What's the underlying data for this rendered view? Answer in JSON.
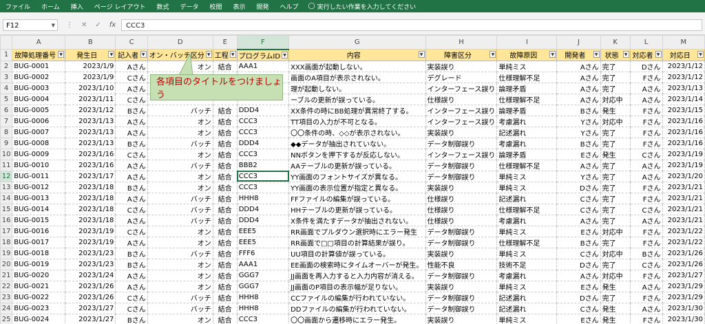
{
  "ribbon": {
    "tabs": [
      "ファイル",
      "ホーム",
      "挿入",
      "ページ レイアウト",
      "数式",
      "データ",
      "校閲",
      "表示",
      "開発",
      "ヘルプ"
    ],
    "tell_me": "実行したい作業を入力してください",
    "color": "#217346"
  },
  "formula_bar": {
    "name_box": "F12",
    "value": "CCC3",
    "icons": [
      "cancel-icon",
      "enter-icon",
      "function-icon"
    ]
  },
  "selected_cell": "F12",
  "columns": [
    "A",
    "B",
    "C",
    "D",
    "E",
    "F",
    "G",
    "H",
    "I",
    "J",
    "K",
    "L",
    "M"
  ],
  "header_row": [
    "故障処理番号",
    "発生日",
    "記入者",
    "オン・バッチ区分",
    "工程",
    "プログラムID",
    "内容",
    "障害区分",
    "故障原因",
    "開発者",
    "状態",
    "対応者",
    "対応日"
  ],
  "header_row_display": [
    "故障処理番号",
    "発生日",
    "記入者",
    "オン・バッチ区分",
    "工程",
    "プログラムID",
    "内容",
    "障害区分",
    "故障原因",
    "開発者",
    "状態",
    "対応者",
    "対応日"
  ],
  "header_color": "#ffe699",
  "callout": {
    "text": "各項目のタイトルをつけましょう",
    "bg": "#c6e0b4",
    "text_color": "#c00000"
  },
  "rows": [
    [
      "BUG-0001",
      "2023/1/9",
      "Aさん",
      "オン",
      "結合",
      "AAA1",
      "XXX画面が起動しない。",
      "実装誤り",
      "単純ミス",
      "Aさん",
      "完了",
      "Dさん",
      "2023/1/12"
    ],
    [
      "BUG-0002",
      "2023/1/9",
      "Cさん",
      "オン",
      "結合",
      "",
      "画面のA項目が表示されない。",
      "デグレード",
      "仕様理解不足",
      "Aさん",
      "完了",
      "Fさん",
      "2023/1/12"
    ],
    [
      "BUG-0003",
      "2023/1/10",
      "Aさん",
      "",
      "",
      "",
      "理が起動しない。",
      "インターフェース誤り",
      "論理矛盾",
      "Aさん",
      "完了",
      "Aさん",
      "2023/1/13"
    ],
    [
      "BUG-0004",
      "2023/1/11",
      "Cさん",
      "",
      "",
      "",
      "ーブルの更新が誤っている。",
      "仕様誤り",
      "仕様理解不足",
      "Aさん",
      "対応中",
      "Aさん",
      "2023/1/14"
    ],
    [
      "BUG-0005",
      "2023/1/12",
      "Bさん",
      "バッチ",
      "結合",
      "DDD4",
      "XX条件の時にBB処理が異常終了する。",
      "インターフェース誤り",
      "論理矛盾",
      "Bさん",
      "発生",
      "Fさん",
      "2023/1/15"
    ],
    [
      "BUG-0006",
      "2023/1/13",
      "Aさん",
      "オン",
      "結合",
      "CCC3",
      "TT項目の入力が不可となる。",
      "インターフェース誤り",
      "考慮漏れ",
      "Yさん",
      "対応中",
      "Fさん",
      "2023/1/16"
    ],
    [
      "BUG-0007",
      "2023/1/13",
      "Aさん",
      "オン",
      "結合",
      "CCC3",
      "〇〇条件の時、◇◇が表示されない。",
      "実装誤り",
      "記述漏れ",
      "Yさん",
      "完了",
      "Fさん",
      "2023/1/16"
    ],
    [
      "BUG-0008",
      "2023/1/13",
      "Bさん",
      "バッチ",
      "結合",
      "DDD4",
      "◆◆データが抽出されていない。",
      "データ制御誤り",
      "考慮漏れ",
      "Bさん",
      "完了",
      "Fさん",
      "2023/1/16"
    ],
    [
      "BUG-0009",
      "2023/1/16",
      "Cさん",
      "オン",
      "結合",
      "CCC3",
      "NNボタンを押下するが反応しない。",
      "インターフェース誤り",
      "論理矛盾",
      "Eさん",
      "発生",
      "Cさん",
      "2023/1/19"
    ],
    [
      "BUG-0010",
      "2023/1/16",
      "Aさん",
      "バッチ",
      "結合",
      "BBB2",
      "AAテーブルの更新が誤っている。",
      "データ制御誤り",
      "仕様理解不足",
      "Aさん",
      "完了",
      "Aさん",
      "2023/1/19"
    ],
    [
      "BUG-0011",
      "2023/1/17",
      "Aさん",
      "オン",
      "結合",
      "CCC3",
      "YY画面のフォントサイズが異なる。",
      "データ制御誤り",
      "単純ミス",
      "Yさん",
      "完了",
      "Aさん",
      "2023/1/20"
    ],
    [
      "BUG-0012",
      "2023/1/18",
      "Bさん",
      "オン",
      "結合",
      "CCC3",
      "YY画面の表示位置が指定と異なる。",
      "実装誤り",
      "単純ミス",
      "Dさん",
      "完了",
      "Fさん",
      "2023/1/21"
    ],
    [
      "BUG-0013",
      "2023/1/18",
      "Aさん",
      "バッチ",
      "結合",
      "HHH8",
      "FFファイルの編集が誤っている。",
      "仕様誤り",
      "記述漏れ",
      "Cさん",
      "完了",
      "Fさん",
      "2023/1/21"
    ],
    [
      "BUG-0014",
      "2023/1/18",
      "Cさん",
      "バッチ",
      "結合",
      "DDD4",
      "HHテーブルの更新が誤っている。",
      "仕様誤り",
      "仕様理解不足",
      "Cさん",
      "完了",
      "Cさん",
      "2023/1/21"
    ],
    [
      "BUG-0015",
      "2023/1/18",
      "Aさん",
      "バッチ",
      "結合",
      "DDD4",
      "X条件を満たすデータが抽出されない。",
      "仕様誤り",
      "考慮漏れ",
      "Aさん",
      "完了",
      "Aさん",
      "2023/1/21"
    ],
    [
      "BUG-0016",
      "2023/1/19",
      "Cさん",
      "オン",
      "結合",
      "EEE5",
      "RR画面でプルダウン選択時にエラー発生",
      "データ制御誤り",
      "単純ミス",
      "Eさん",
      "対応中",
      "Fさん",
      "2023/1/22"
    ],
    [
      "BUG-0017",
      "2023/1/19",
      "Aさん",
      "オン",
      "結合",
      "EEE5",
      "RR画面で□□項目の計算結果が誤り。",
      "データ制御誤り",
      "仕様理解不足",
      "Bさん",
      "完了",
      "Fさん",
      "2023/1/22"
    ],
    [
      "BUG-0018",
      "2023/1/23",
      "Bさん",
      "バッチ",
      "結合",
      "FFF6",
      "UU項目の計算値が誤っている。",
      "実装誤り",
      "単純ミス",
      "Cさん",
      "対応中",
      "Bさん",
      "2023/1/26"
    ],
    [
      "BUG-0019",
      "2023/1/23",
      "Bさん",
      "オン",
      "結合",
      "AAA1",
      "EE画面の検索時にタイムオーバーが発生。",
      "性能不良",
      "技術不足",
      "Dさん",
      "完了",
      "Cさん",
      "2023/1/26"
    ],
    [
      "BUG-0020",
      "2023/1/24",
      "Aさん",
      "オン",
      "結合",
      "GGG7",
      "JJ画面を再入力すると入力内容が消える。",
      "データ制御誤り",
      "考慮漏れ",
      "Aさん",
      "対応中",
      "Fさん",
      "2023/1/27"
    ],
    [
      "BUG-0021",
      "2023/1/26",
      "Aさん",
      "オン",
      "結合",
      "GGG7",
      "JJ画面のP項目の表示幅が足りない。",
      "実装誤り",
      "単純ミス",
      "Eさん",
      "発生",
      "Aさん",
      "2023/1/29"
    ],
    [
      "BUG-0022",
      "2023/1/26",
      "Cさん",
      "バッチ",
      "結合",
      "HHH8",
      "CCファイルの編集が行われていない。",
      "データ制御誤り",
      "記述漏れ",
      "Dさん",
      "完了",
      "Fさん",
      "2023/1/29"
    ],
    [
      "BUG-0023",
      "2023/1/27",
      "Cさん",
      "バッチ",
      "結合",
      "HHH8",
      "DDファイルの編集が行われていない。",
      "データ制御誤り",
      "記述漏れ",
      "Cさん",
      "発生",
      "Aさん",
      "2023/1/30"
    ],
    [
      "BUG-0024",
      "2023/1/27",
      "Bさん",
      "オン",
      "結合",
      "CCC3",
      "〇〇画面から遷移時にエラー発生。",
      "実装誤り",
      "単純ミス",
      "Eさん",
      "発生",
      "Fさん",
      "2023/1/30"
    ],
    [
      "BUG-0025",
      "2023/1/27",
      "Aさん",
      "バッチ",
      "結合",
      "HHH8",
      "MMテーブルの更新が誤っている。",
      "仕様誤り",
      "仕様理解不足",
      "Aさん",
      "発生",
      "Fさん",
      "2023/1/30"
    ]
  ]
}
